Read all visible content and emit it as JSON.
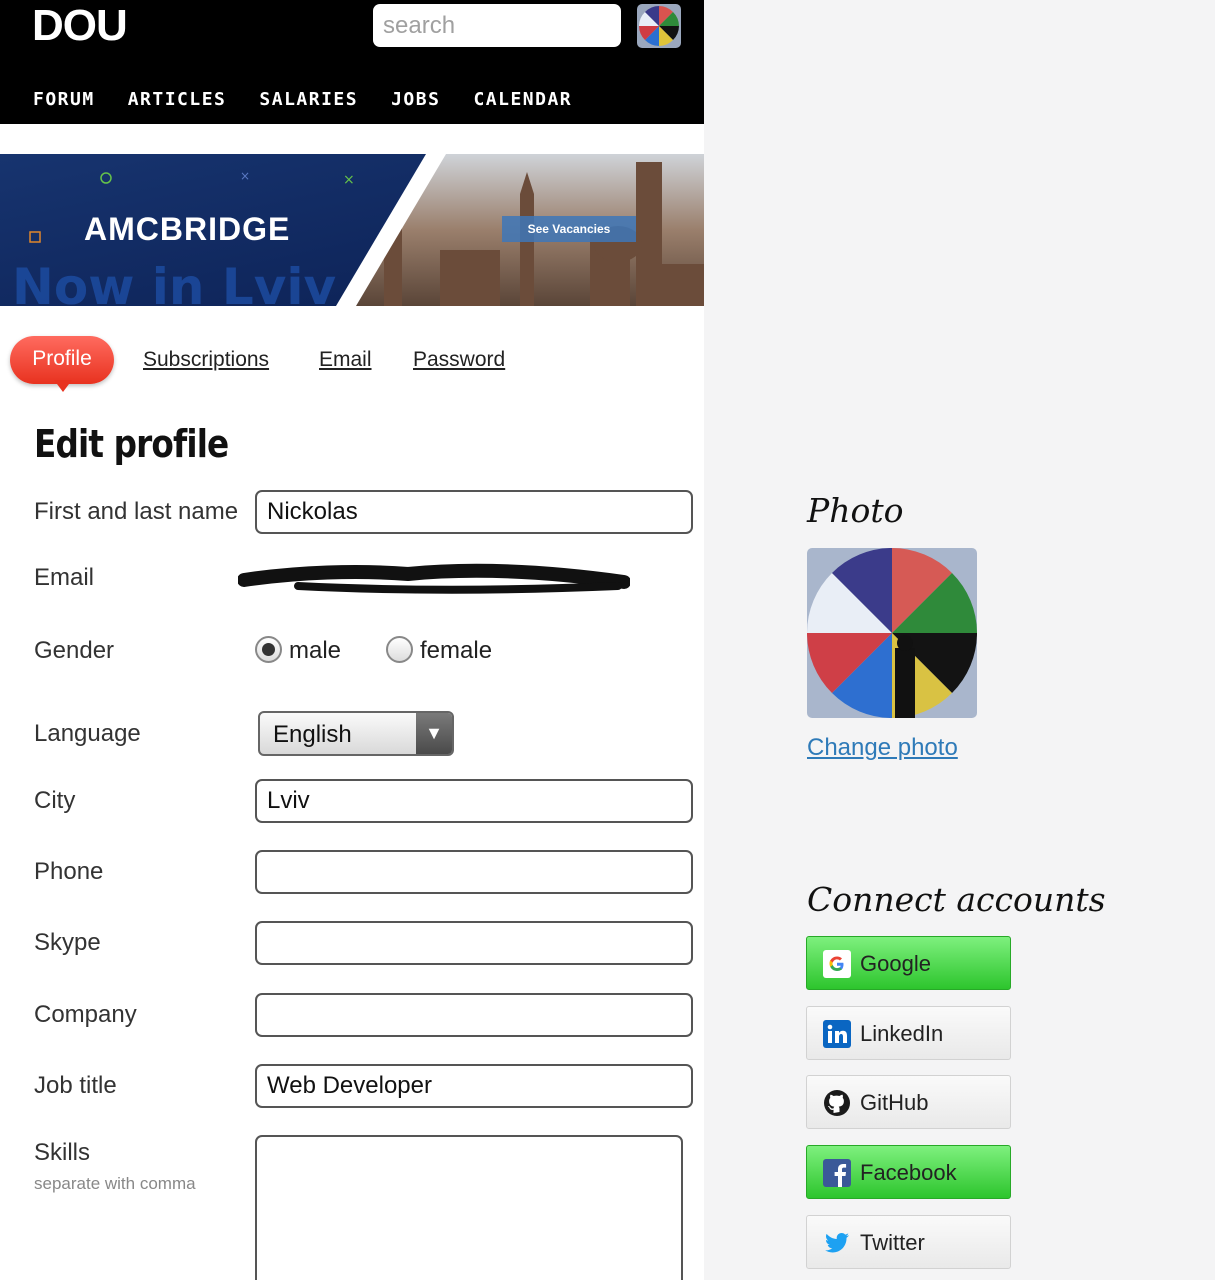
{
  "header": {
    "logo": "DOU",
    "search_placeholder": "search",
    "nav": [
      "FORUM",
      "ARTICLES",
      "SALARIES",
      "JOBS",
      "CALENDAR"
    ]
  },
  "banner": {
    "brand": "AMCBRIDGE",
    "tagline": "Now in Lviv",
    "cta": "See Vacancies"
  },
  "tabs": {
    "active": "Profile",
    "links": [
      "Subscriptions",
      "Email",
      "Password"
    ]
  },
  "form": {
    "title": "Edit profile",
    "name_label": "First and last name",
    "name_value": "Nickolas",
    "email_label": "Email",
    "gender_label": "Gender",
    "gender_options": [
      "male",
      "female"
    ],
    "gender_selected": "male",
    "language_label": "Language",
    "language_value": "English",
    "city_label": "City",
    "city_value": "Lviv",
    "phone_label": "Phone",
    "phone_value": "",
    "skype_label": "Skype",
    "skype_value": "",
    "company_label": "Company",
    "company_value": "",
    "job_label": "Job title",
    "job_value": "Web Developer",
    "skills_label": "Skills",
    "skills_hint": "separate with comma",
    "skills_value": ""
  },
  "sidebar": {
    "photo_heading": "Photo",
    "change_photo": "Change photo",
    "connect_heading": "Connect accounts",
    "accounts": [
      {
        "label": "Google",
        "icon": "google-icon",
        "connected": true
      },
      {
        "label": "LinkedIn",
        "icon": "linkedin-icon",
        "connected": false
      },
      {
        "label": "GitHub",
        "icon": "github-icon",
        "connected": false
      },
      {
        "label": "Facebook",
        "icon": "facebook-icon",
        "connected": true
      },
      {
        "label": "Twitter",
        "icon": "twitter-icon",
        "connected": false
      }
    ]
  },
  "colors": {
    "active_tab": "#e8321f",
    "connected": "#2dc52d",
    "link": "#2e7ab8"
  }
}
